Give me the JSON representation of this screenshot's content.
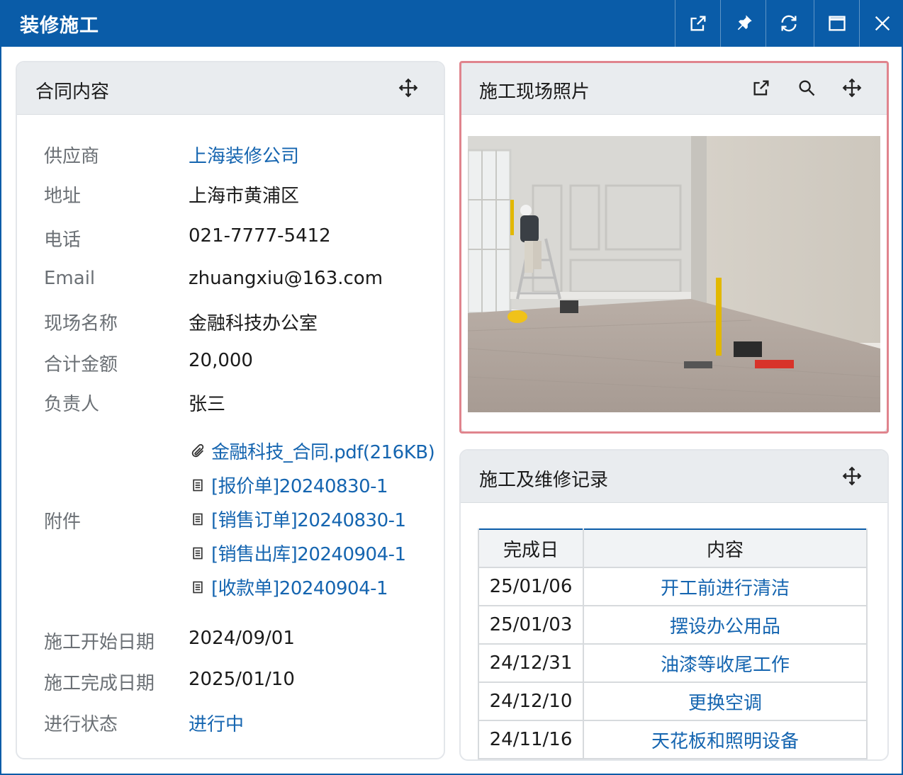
{
  "window": {
    "title": "装修施工",
    "buttons": [
      "external-link-icon",
      "pin-icon",
      "refresh-icon",
      "maximize-icon",
      "close-icon"
    ]
  },
  "contract": {
    "title": "合同内容",
    "fields": {
      "supplier_label": "供应商",
      "supplier_value": "上海装修公司",
      "address_label": "地址",
      "address_value": "上海市黄浦区",
      "phone_label": "电话",
      "phone_value": "021-7777-5412",
      "email_label": "Email",
      "email_value": "zhuangxiu@163.com",
      "site_label": "现场名称",
      "site_value": "金融科技办公室",
      "amount_label": "合计金额",
      "amount_value": "20,000",
      "owner_label": "负责人",
      "owner_value": "张三",
      "attachments_label": "附件",
      "start_label": "施工开始日期",
      "start_value": "2024/09/01",
      "end_label": "施工完成日期",
      "end_value": "2025/01/10",
      "status_label": "进行状态",
      "status_value": "进行中"
    },
    "attachments": [
      {
        "icon": "paperclip-icon",
        "text": "金融科技_合同.pdf(216KB)"
      },
      {
        "icon": "document-icon",
        "text": "[报价单]20240830-1"
      },
      {
        "icon": "document-icon",
        "text": "[销售订单]20240830-1"
      },
      {
        "icon": "document-icon",
        "text": "[销售出库]20240904-1"
      },
      {
        "icon": "document-icon",
        "text": "[收款单]20240904-1"
      }
    ]
  },
  "photo": {
    "title": "施工现场照片",
    "icons": [
      "external-link-icon",
      "search-icon",
      "move-icon"
    ]
  },
  "records": {
    "title": "施工及维修记录",
    "columns": [
      "完成日",
      "内容"
    ],
    "rows": [
      {
        "date": "25/01/06",
        "content": "开工前进行清洁"
      },
      {
        "date": "25/01/03",
        "content": "摆设办公用品"
      },
      {
        "date": "24/12/31",
        "content": "油漆等收尾工作"
      },
      {
        "date": "24/12/10",
        "content": "更换空调"
      },
      {
        "date": "24/11/16",
        "content": "天花板和照明设备"
      }
    ]
  },
  "colors": {
    "titlebar": "#0a5ca8",
    "link": "#1565b0",
    "selection_border": "#e0848d",
    "panel_header": "#e9ecef"
  }
}
